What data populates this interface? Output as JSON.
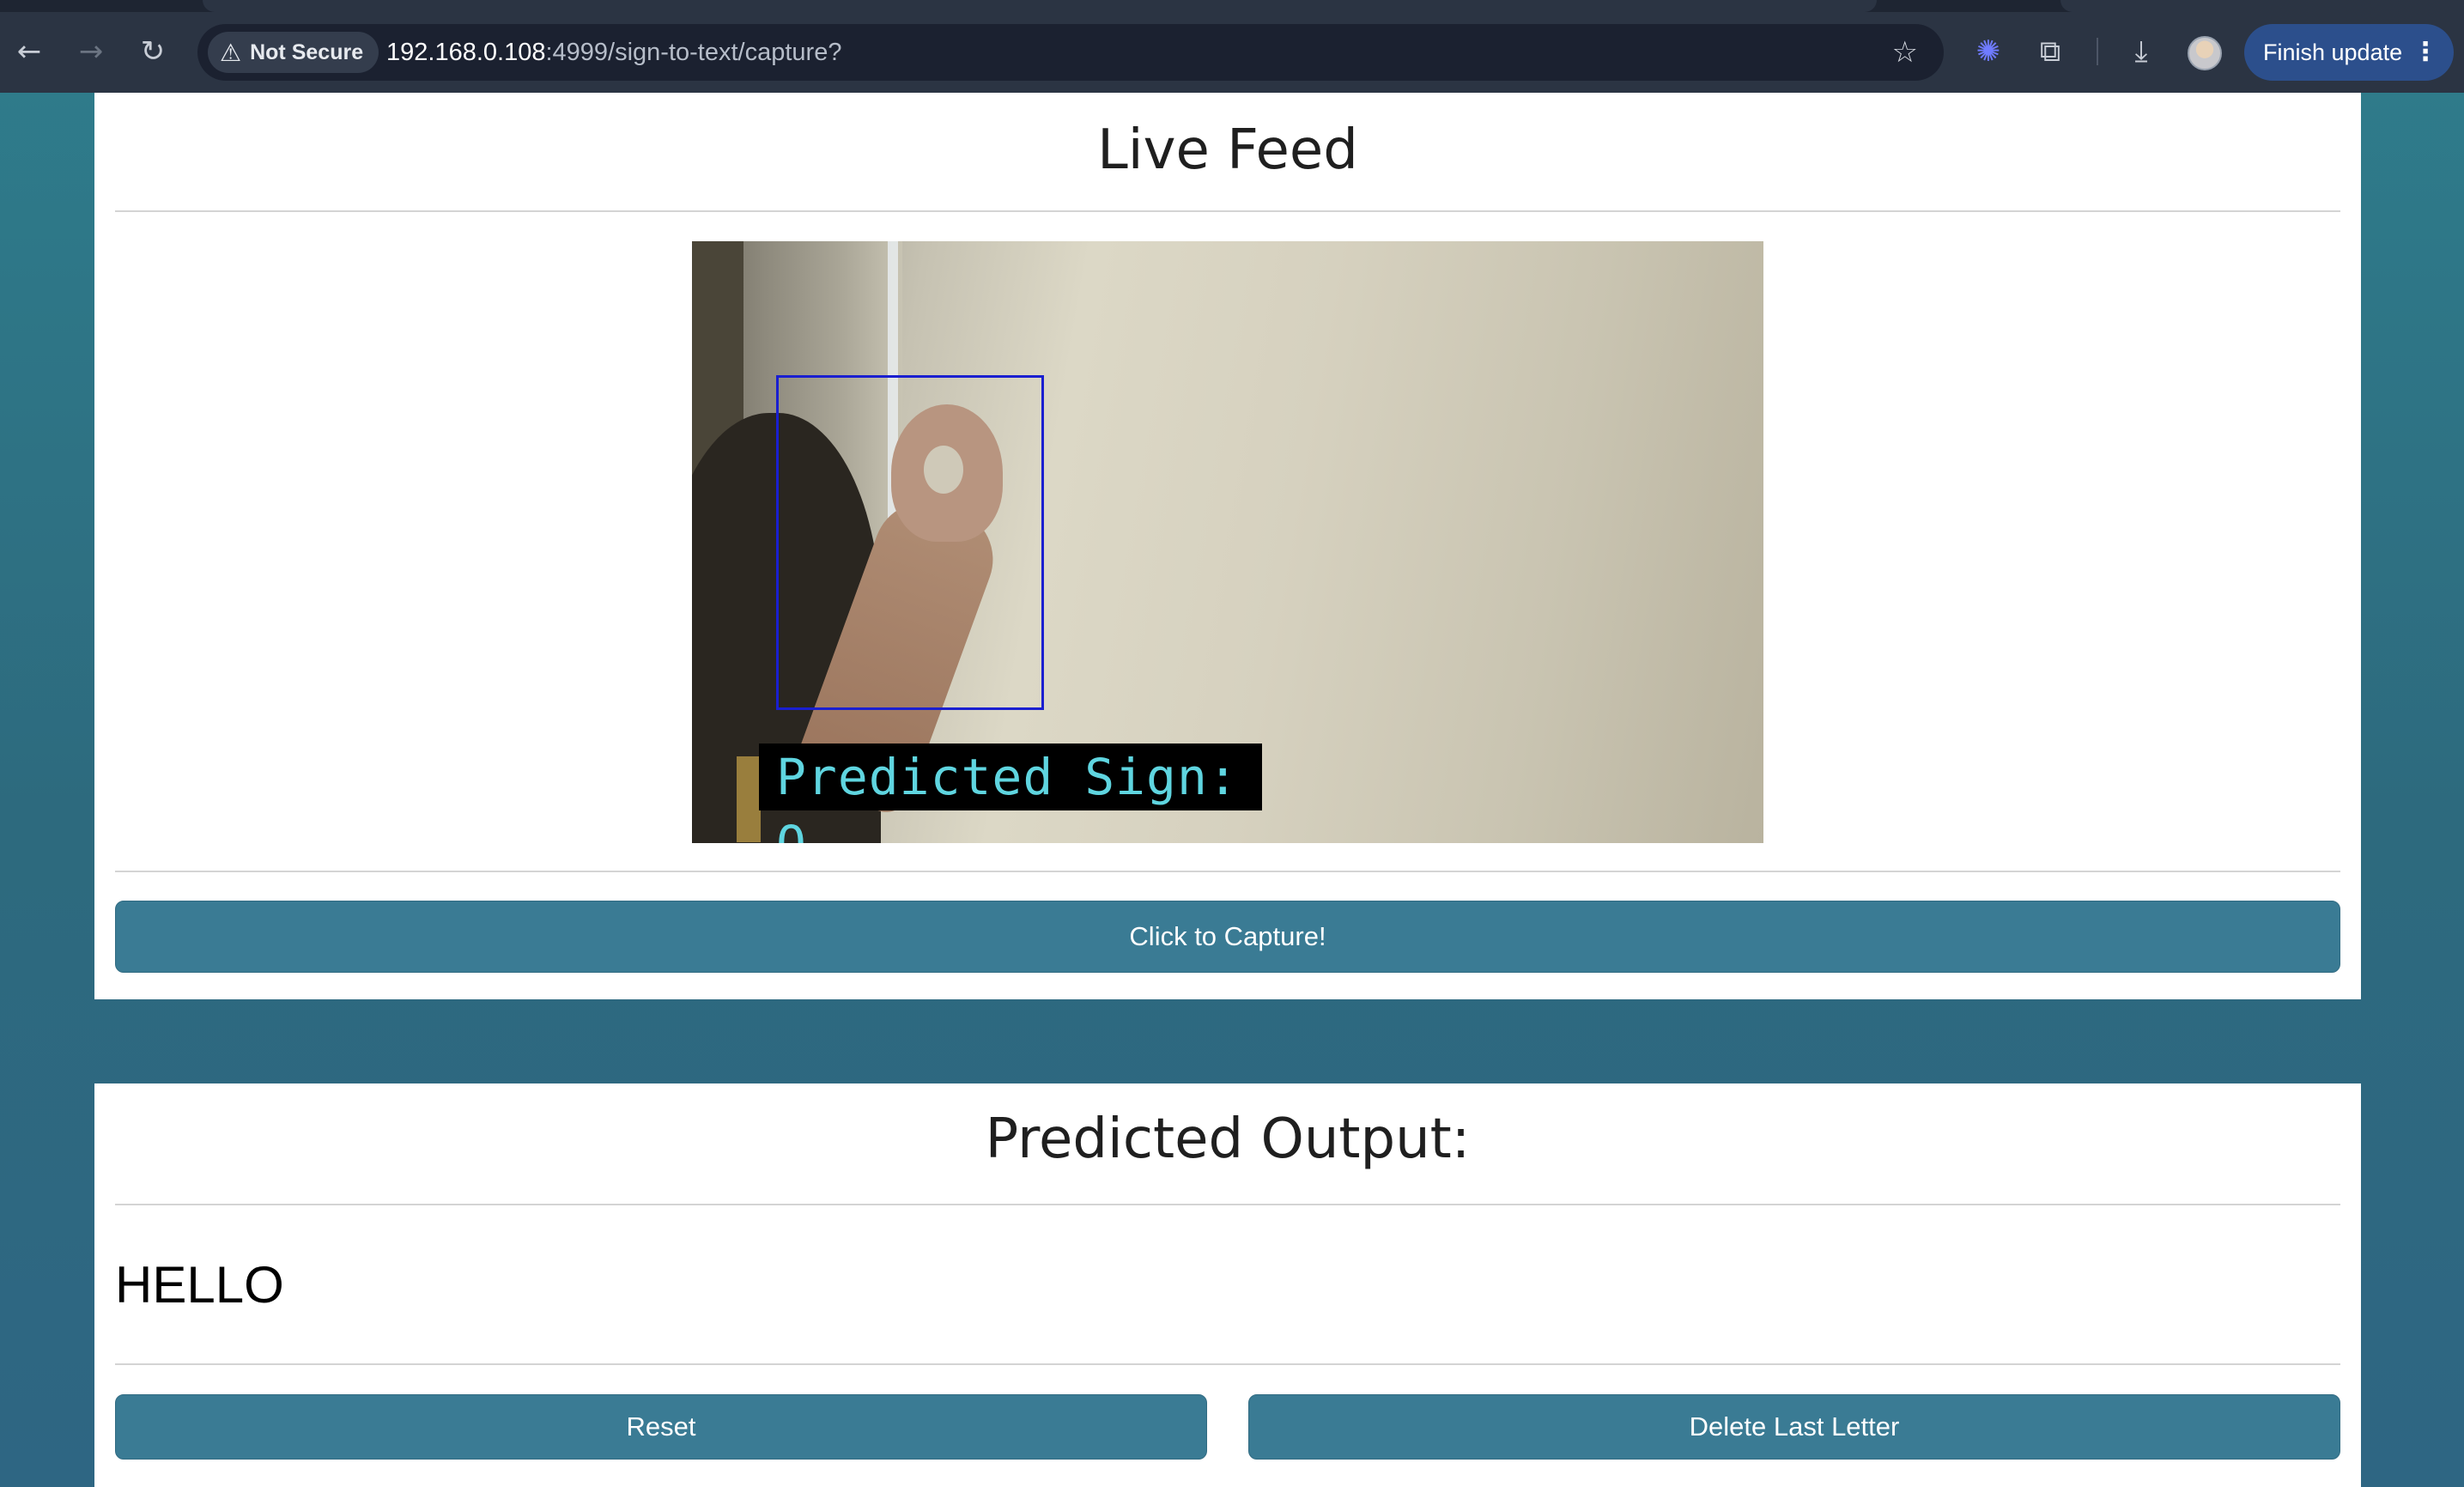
{
  "browser": {
    "security_chip": "Not Secure",
    "url_host": "192.168.0.108",
    "url_path": ":4999/sign-to-text/capture?",
    "finish_update_label": "Finish update"
  },
  "live_feed": {
    "title": "Live Feed",
    "overlay_text": "Predicted Sign: O",
    "capture_button": "Click to Capture!"
  },
  "output": {
    "title": "Predicted Output:",
    "text": "HELLO",
    "reset_button": "Reset",
    "delete_button": "Delete Last Letter"
  },
  "icons": [
    "back-icon",
    "forward-icon",
    "reload-icon",
    "warning-icon",
    "star-icon",
    "extension-puzzle-icon",
    "gemini-icon",
    "download-icon",
    "avatar",
    "more-icon"
  ]
}
